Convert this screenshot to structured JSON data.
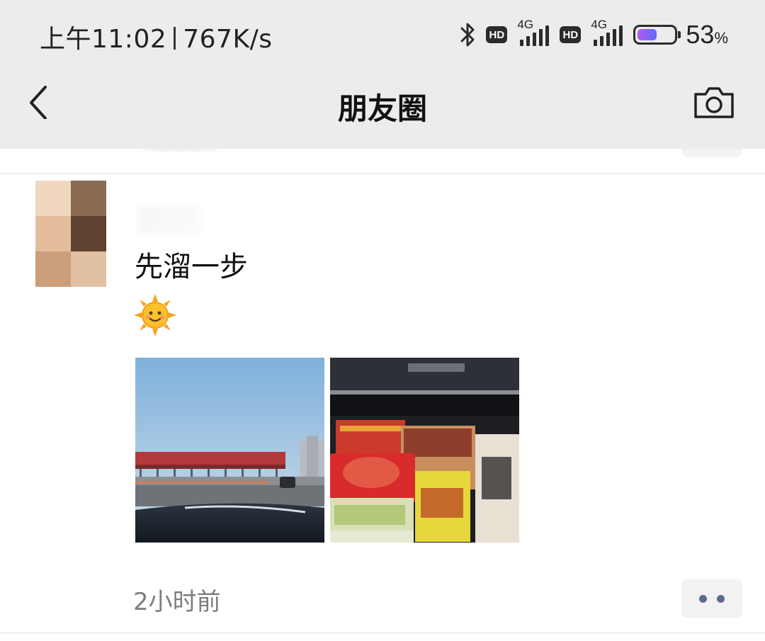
{
  "status_bar": {
    "time": "上午11:02",
    "net_speed": "767K/s",
    "icons": [
      "bluetooth-icon",
      "hd-icon",
      "signal-4g-icon",
      "hd-icon",
      "signal-4g-icon",
      "battery-icon"
    ],
    "hd_label": "HD",
    "network_1": "4G",
    "network_2": "4G",
    "battery_level": 0.53,
    "battery_percent": "53",
    "battery_unit": "%"
  },
  "nav": {
    "title": "朋友圈",
    "back_icon": "back-arrow-icon",
    "camera_icon": "camera-icon"
  },
  "post": {
    "text": "先溜一步",
    "emoji": "☀",
    "timestamp": "2小时前",
    "more_icon": "more-dots-icon",
    "photos": [
      {
        "name": "toll-station-photo"
      },
      {
        "name": "car-trunk-gifts-photo"
      }
    ]
  },
  "colors": {
    "bar_bg": "#ececec",
    "timestamp": "#7d7d7d",
    "more_dots": "#5a6b8c",
    "battery_gradient_start": "#b659f5",
    "battery_gradient_end": "#5b6cf6"
  }
}
